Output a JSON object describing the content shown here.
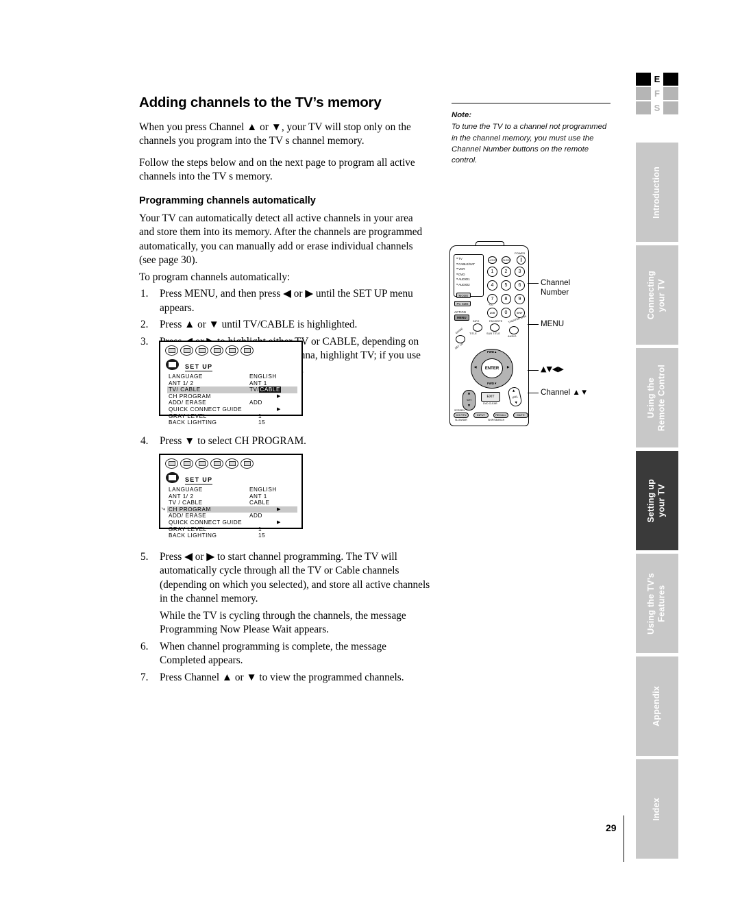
{
  "document": {
    "page_number": "29",
    "title": "Adding channels to the TV’s memory",
    "subtitle": "Programming channels automatically"
  },
  "body": {
    "para1": "When you press Channel ▲ or ▼, your TV will stop only on the channels you program into the TV s channel memory.",
    "para2": "Follow the steps below and on the next page to program all active channels into the TV s memory.",
    "para3": "Your TV can automatically detect all active channels in your area and store them into its memory. After the channels are programmed automatically, you can manually add or erase individual channels (see page 30).",
    "para4": "To program channels automatically:"
  },
  "steps": [
    {
      "num": "1.",
      "text": "Press MENU, and then press ◀ or ▶ until the SET UP menu appears."
    },
    {
      "num": "2.",
      "text": "Press ▲ or ▼ until TV/CABLE is highlighted."
    },
    {
      "num": "3.",
      "text": "Press ◀ or ▶ to highlight either TV or CABLE, depending on which you use. If you use an antenna, highlight TV; if you use cable channels, highlight CABLE."
    },
    {
      "num": "4.",
      "text": "Press ▼ to select CH PROGRAM."
    },
    {
      "num": "5.",
      "text": "Press ◀ or ▶ to start channel programming. The TV will automatically cycle through all the TV or Cable channels (depending on which you selected), and store all active channels in the channel memory."
    },
    {
      "num": "6.",
      "text": "When channel programming is complete, the message  Completed  appears."
    },
    {
      "num": "7.",
      "text": "Press Channel ▲ or ▼ to view the programmed channels."
    }
  ],
  "step5_sub": "While the TV is cycling through the channels, the message  Programming Now   Please Wait  appears.",
  "note": {
    "label": "Note:",
    "text": "To tune the TV to a channel not programmed in the channel memory, you must use the Channel Number buttons on the remote control."
  },
  "osd1": {
    "menu_title": "SET UP",
    "rows": [
      {
        "label": "LANGUAGE",
        "value": "ENGLISH",
        "arrow": "",
        "highlighted": false
      },
      {
        "label": "ANT 1/ 2",
        "value": "ANT 1",
        "arrow": "",
        "highlighted": false
      },
      {
        "label": "TV/ CABLE",
        "value": "TV/",
        "value_inverted": "CABLE",
        "arrow": "",
        "highlighted": true
      },
      {
        "label": "CH  PROGRAM",
        "value": "",
        "arrow": "▶",
        "highlighted": false
      },
      {
        "label": "ADD/ ERASE",
        "value": "ADD",
        "arrow": "",
        "highlighted": false
      },
      {
        "label": "QUICK CONNECT GUIDE",
        "value": "",
        "arrow": "▶",
        "highlighted": false
      },
      {
        "label": "GRAY LEVEL",
        "value": "1",
        "arrow": "",
        "highlighted": false,
        "numeric": true
      },
      {
        "label": "BACK LIGHTING",
        "value": "15",
        "arrow": "",
        "highlighted": false,
        "numeric": true
      }
    ]
  },
  "osd2": {
    "menu_title": "SET UP",
    "rows": [
      {
        "label": "LANGUAGE",
        "value": "ENGLISH",
        "arrow": "",
        "highlighted": false
      },
      {
        "label": "ANT 1/ 2",
        "value": "ANT 1",
        "arrow": "",
        "highlighted": false
      },
      {
        "label": "TV / CABLE",
        "value": "CABLE",
        "arrow": "",
        "highlighted": false
      },
      {
        "label": "CH  PROGRAM",
        "value": "",
        "arrow": "▶",
        "highlighted": true
      },
      {
        "label": "ADD/ ERASE",
        "value": "ADD",
        "arrow": "",
        "highlighted": false
      },
      {
        "label": "QUICK CONNECT GUIDE",
        "value": "",
        "arrow": "▶",
        "highlighted": false
      },
      {
        "label": "GRAY LEVEL",
        "value": "1",
        "arrow": "",
        "highlighted": false,
        "numeric": true
      },
      {
        "label": "BACK LIGHTING",
        "value": "15",
        "arrow": "",
        "highlighted": false,
        "numeric": true
      }
    ]
  },
  "remote": {
    "modes": [
      "TV",
      "CABLE/SAT",
      "VCR",
      "DVD",
      "AUDIO1",
      "AUDIO2"
    ],
    "mode_button": "MODE",
    "pc_size_button": "PC SIZE",
    "action_label": "ACTION",
    "menu_button": "MENU",
    "power_label": "POWER",
    "top_buttons": [
      "LIGHT",
      "SLEEP"
    ],
    "numbers": [
      "1",
      "2",
      "3",
      "4",
      "5",
      "6",
      "7",
      "8",
      "9",
      "100",
      "0",
      "ENT"
    ],
    "plus_ten": "+10",
    "mid_buttons": [
      "INFO",
      "FAVORITE",
      "THEATER LINK"
    ],
    "mid_sub": [
      "TITLE",
      "SUB TITLE",
      "AUDIO"
    ],
    "guide_button": "GUIDE",
    "setup_label": "SET UP",
    "dpad": {
      "up": "FWD▲",
      "down": "FWD▼",
      "center": "ENTER",
      "left": "◀",
      "right": "▶"
    },
    "ch_rocker": "CH",
    "vol_rocker": "VOL",
    "exit_button": "EXIT",
    "exit_sub": "DVD CLEAR",
    "bottom_buttons": [
      "CH RTN",
      "INPUT",
      "RECALL",
      "MUTE"
    ],
    "bottom_labels": [
      "SCREEN",
      "SLOW/DIR",
      "SKIP/SEARCH"
    ]
  },
  "callouts": {
    "channel_number": "Channel\nNumber",
    "channel_number_l1": "Channel",
    "channel_number_l2": "Number",
    "menu": "MENU",
    "arrows": "▲▼◀▶",
    "channel_updown": "Channel ▲▼"
  },
  "sidebar": {
    "languages": [
      {
        "letter": "E",
        "active": true
      },
      {
        "letter": "F",
        "active": false
      },
      {
        "letter": "S",
        "active": false
      }
    ],
    "tabs": [
      {
        "label": "Introduction",
        "active": false
      },
      {
        "label": "Connecting\nyour TV",
        "active": false
      },
      {
        "label": "Using the\nRemote Control",
        "active": false
      },
      {
        "label": "Setting up\nyour TV",
        "active": true
      },
      {
        "label": "Using the TV’s\nFeatures",
        "active": false
      },
      {
        "label": "Appendix",
        "active": false
      },
      {
        "label": "Index",
        "active": false
      }
    ]
  }
}
